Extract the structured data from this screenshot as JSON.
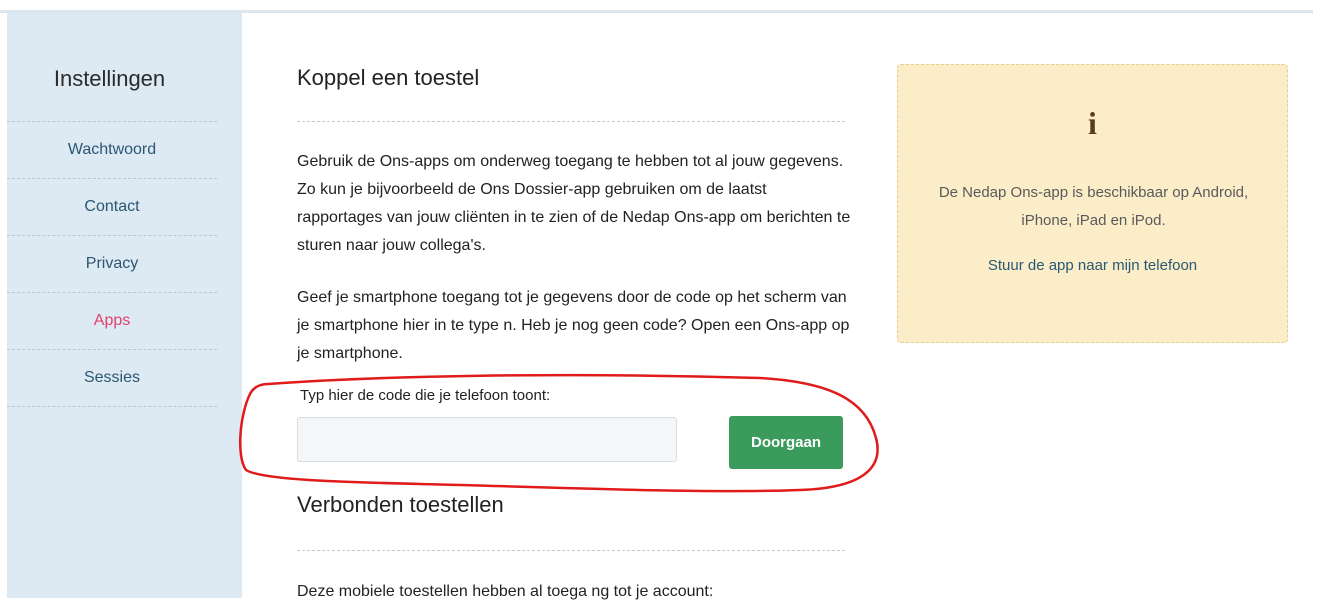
{
  "sidebar": {
    "title": "Instellingen",
    "items": [
      {
        "label": "Wachtwoord"
      },
      {
        "label": "Contact"
      },
      {
        "label": "Privacy"
      },
      {
        "label": "Apps"
      },
      {
        "label": "Sessies"
      }
    ],
    "active_item": "Apps"
  },
  "main": {
    "koppel_title": "Koppel een toestel",
    "paragraph1": "Gebruik de Ons-apps om onderweg toegang te hebben tot al jouw gegevens. Zo kun je bijvoorbeeld de Ons Dossier-app gebruiken om de laatst rapportages van jouw cliënten in te zien of de Nedap Ons-app om berichten te sturen naar jouw collega's.",
    "paragraph2": "Geef je smartphone toegang tot je gegevens door de code op het scherm van je smartphone hier in te type n. Heb je nog geen code? Open een Ons-app op je smartphone.",
    "code_label": "Typ hier de code die je telefoon toont:",
    "code_value": "",
    "code_placeholder": "",
    "submit_label": "Doorgaan",
    "verbonden_title": "Verbonden toestellen",
    "paragraph3": "Deze mobiele toestellen hebben al toega ng tot je account:"
  },
  "info": {
    "icon": "info-icon",
    "icon_glyph": "i",
    "text": "De Nedap Ons-app is beschikbaar op Android, iPhone, iPad en iPod.",
    "link": "Stuur de app naar mijn telefoon"
  },
  "colors": {
    "sidebar_bg": "#dde9f3",
    "active_link": "#e0436a",
    "link": "#2a5873",
    "button_bg": "#3a9b5c",
    "info_bg": "#fcedc9",
    "annotation": "#e01b1b"
  }
}
